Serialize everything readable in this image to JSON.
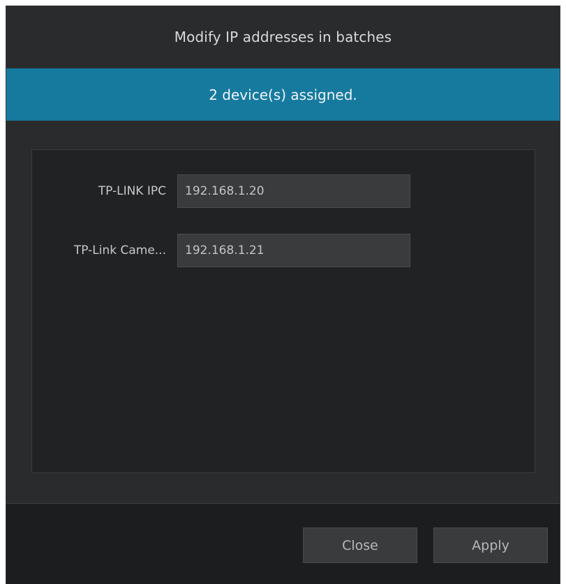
{
  "dialog": {
    "title": "Modify IP addresses in batches",
    "banner": "2 device(s) assigned."
  },
  "devices": [
    {
      "name": "TP-LINK IPC",
      "ip": "192.168.1.20"
    },
    {
      "name": "TP-Link Came...",
      "ip": "192.168.1.21"
    }
  ],
  "footer": {
    "close_label": "Close",
    "apply_label": "Apply"
  },
  "colors": {
    "banner": "#167a9f",
    "background": "#2a2b2d",
    "panel": "#212223"
  }
}
